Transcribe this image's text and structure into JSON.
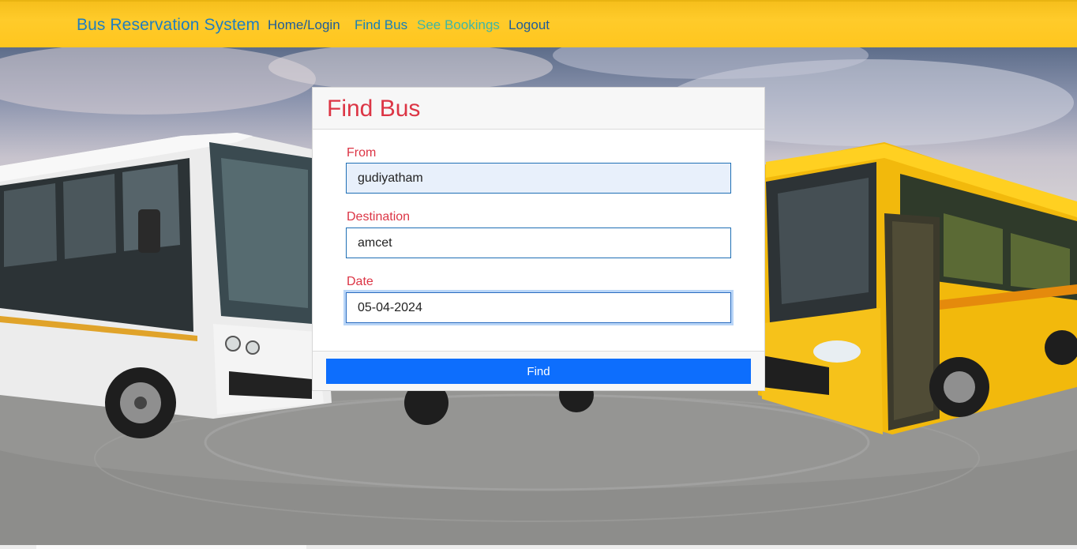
{
  "navbar": {
    "brand": "Bus Reservation System",
    "links": [
      {
        "label": "Home/Login"
      },
      {
        "label": "Find Bus"
      },
      {
        "label": "See Bookings"
      },
      {
        "label": "Logout"
      }
    ]
  },
  "card": {
    "title": "Find Bus",
    "from": {
      "label": "From",
      "value": "gudiyatham"
    },
    "destination": {
      "label": "Destination",
      "value": "amcet"
    },
    "date": {
      "label": "Date",
      "value": "05-04-2024"
    },
    "submit_label": "Find"
  },
  "colors": {
    "navbar": "#ffc61e",
    "brand_text": "#1f7ec0",
    "accent_red": "#dc3545",
    "button_blue": "#0d6efd"
  }
}
